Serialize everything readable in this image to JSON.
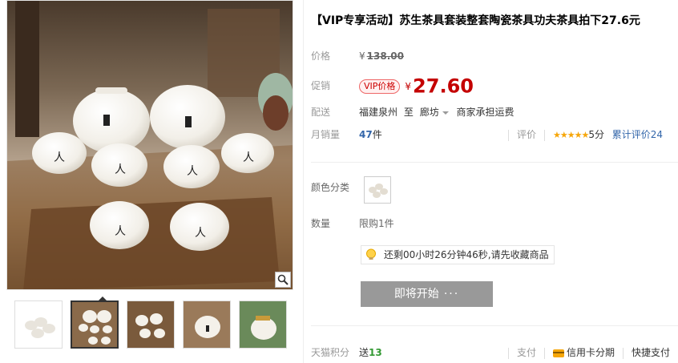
{
  "product": {
    "title": "【VIP专享活动】苏生茶具套装整套陶瓷茶具功夫茶具拍下27.6元"
  },
  "price": {
    "label": "价格",
    "yen": "¥",
    "original": "138.00"
  },
  "promo": {
    "label": "促销",
    "tag": "VIP价格",
    "yen": "¥",
    "value": "27.60"
  },
  "delivery": {
    "label": "配送",
    "from": "福建泉州",
    "to_word": "至",
    "destination": "廊坊",
    "fee": "商家承担运费"
  },
  "sales": {
    "label": "月销量",
    "count": "47",
    "unit": "件",
    "rating_label": "评价",
    "stars": "★★★★★",
    "score": "5分",
    "total_label": "累计评价24"
  },
  "sku": {
    "color_label": "颜色分类",
    "quantity_label": "数量",
    "quantity_limit": "限购1件"
  },
  "notice": {
    "text": "还剩00小时26分钟46秒,请先收藏商品"
  },
  "buy": {
    "label": "即将开始",
    "dots": "···"
  },
  "footer": {
    "points_label": "天猫积分",
    "points_prefix": "送",
    "points_value": "13",
    "pay_label": "支付",
    "credit_label": "信用卡分期",
    "quick_pay_label": "快捷支付"
  },
  "colors": {
    "price_red": "#c40000",
    "link_blue": "#3366aa",
    "points_green": "#339933",
    "button_gray": "#999999",
    "star_orange": "#f6a609"
  }
}
